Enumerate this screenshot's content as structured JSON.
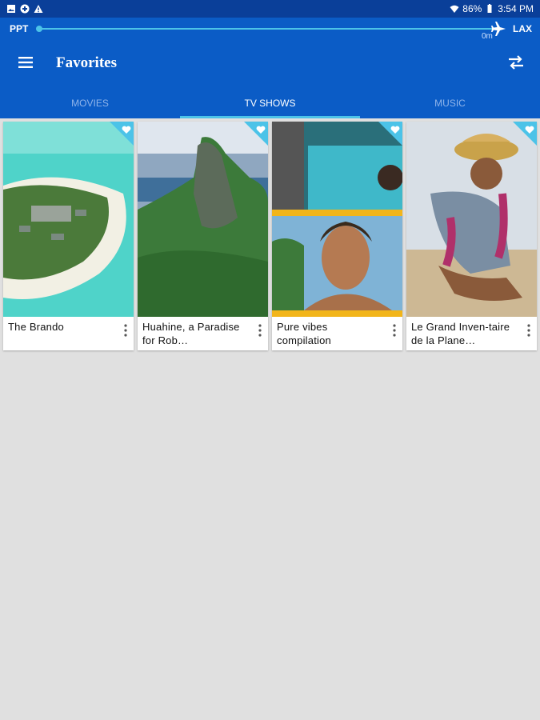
{
  "status": {
    "battery": "86%",
    "time": "3:54 PM"
  },
  "route": {
    "origin": "PPT",
    "destination": "LAX",
    "distance": "0m"
  },
  "header": {
    "title": "Favorites"
  },
  "tabs": [
    {
      "label": "MOVIES",
      "active": false
    },
    {
      "label": "TV SHOWS",
      "active": true
    },
    {
      "label": "MUSIC",
      "active": false
    }
  ],
  "cards": [
    {
      "title": "The Brando",
      "favorite": true
    },
    {
      "title": "Huahine, a Paradise for Rob…",
      "favorite": true
    },
    {
      "title": "Pure vibes compilation",
      "favorite": true
    },
    {
      "title": "Le Grand Inven-taire de la Plane…",
      "favorite": true
    }
  ],
  "colors": {
    "header": "#0b5cc6",
    "statusbar": "#0a3f99",
    "accent": "#4cc3e8",
    "background": "#e0e0e0"
  }
}
